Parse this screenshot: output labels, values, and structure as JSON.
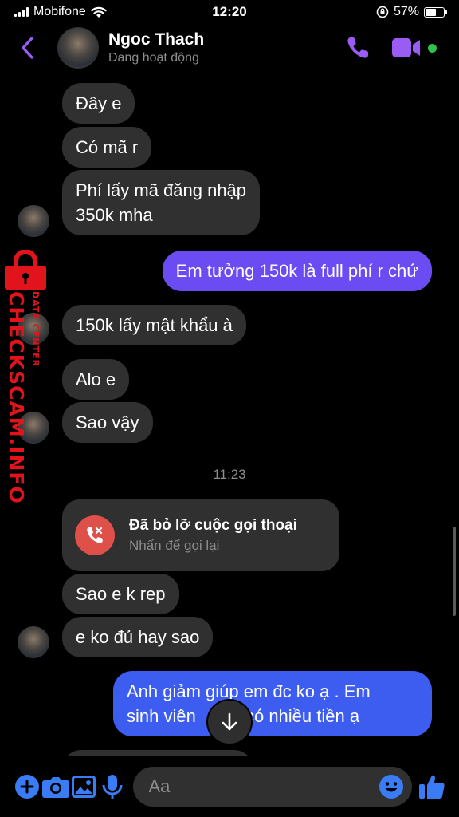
{
  "status": {
    "carrier": "Mobifone",
    "time": "12:20",
    "battery": "57%",
    "battery_level": 0.57
  },
  "header": {
    "name": "Ngoc Thach",
    "status": "Đang hoạt động"
  },
  "messages": {
    "m1": "Đây e",
    "m2": "Có mã r",
    "m3_l1": "Phí lấy mã đăng nhập",
    "m3_l2": "350k mha",
    "m4": "Em tưởng 150k là full phí r chứ",
    "m5": "150k lấy mật khẩu à",
    "m6": "Alo e",
    "m7": "Sao vậy",
    "timestamp": "11:23",
    "missed_title": "Đã bỏ lỡ cuộc gọi thoại",
    "missed_sub": "Nhấn để gọi lại",
    "m8": "Sao e k rep",
    "m9": "e ko đủ hay sao",
    "m10_l1": "Anh giảm giúp em đc ko ạ . Em",
    "m10_l2": "sinh viên",
    "m10_l3": "có nhiều tiền ạ"
  },
  "watermark": {
    "main": "CHECKSCAM.INFO",
    "sub": "DATA CENTER"
  },
  "composer": {
    "placeholder": "Aa"
  },
  "colors": {
    "accent": "#6b4cf2",
    "outgoing_blue": "#3d5cf0",
    "incoming": "#303030",
    "icon_blue": "#3a7cf6",
    "missed": "#e0504a",
    "online": "#31c24d",
    "watermark": "#e2141b"
  }
}
